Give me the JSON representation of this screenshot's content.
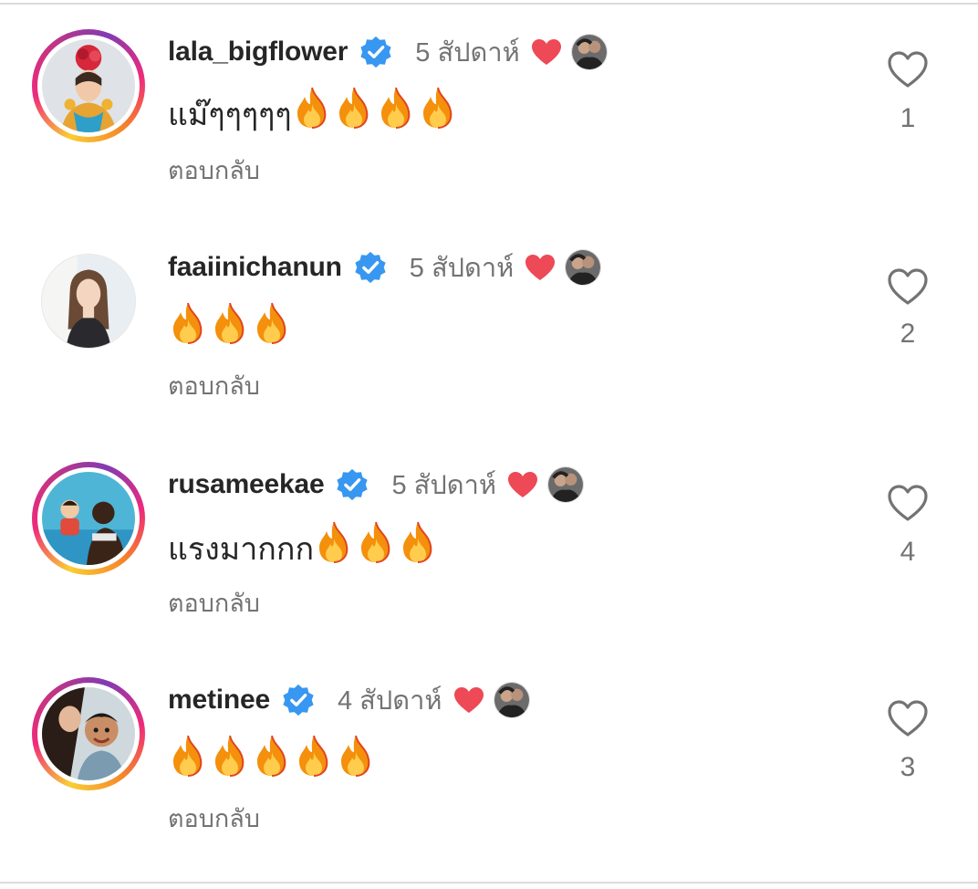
{
  "comments": [
    {
      "username": "lala_bigflower",
      "verified": true,
      "time": "5 สัปดาห์",
      "liked_by_author": true,
      "story_ring": true,
      "text": "แม๊ๆๆๆๆๆ",
      "fire_count": 4,
      "reply_label": "ตอบกลับ",
      "like_count": "1"
    },
    {
      "username": "faaiinichanun",
      "verified": true,
      "time": "5 สัปดาห์",
      "liked_by_author": true,
      "story_ring": false,
      "text": "",
      "fire_count": 3,
      "reply_label": "ตอบกลับ",
      "like_count": "2"
    },
    {
      "username": "rusameekae",
      "verified": true,
      "time": "5 สัปดาห์",
      "liked_by_author": true,
      "story_ring": true,
      "text": "แรงมากกก",
      "fire_count": 3,
      "reply_label": "ตอบกลับ",
      "like_count": "4"
    },
    {
      "username": "metinee",
      "verified": true,
      "time": "4 สัปดาห์",
      "liked_by_author": true,
      "story_ring": true,
      "text": "",
      "fire_count": 5,
      "reply_label": "ตอบกลับ",
      "like_count": "3"
    }
  ],
  "colors": {
    "verified_badge": "#3897f0",
    "liked_heart": "#ed4956",
    "muted_text": "#737373",
    "primary_text": "#262626"
  },
  "icons": {
    "verified": "verified-badge-icon",
    "liked": "heart-filled-icon",
    "like_button": "heart-outline-icon",
    "emoji": "fire-emoji-icon"
  }
}
